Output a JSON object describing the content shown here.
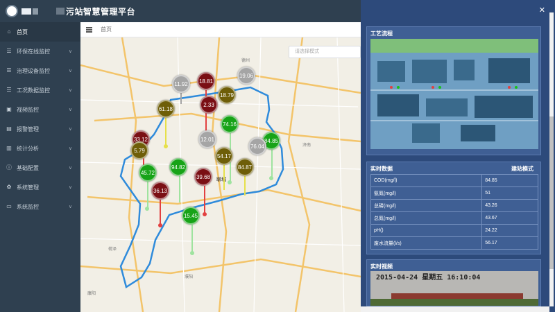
{
  "header": {
    "title": "污站智慧管理平台"
  },
  "sidebar": {
    "items": [
      {
        "label": "首页",
        "icon": "home-icon"
      },
      {
        "label": "环保在线监控",
        "icon": "list-icon"
      },
      {
        "label": "治理设备监控",
        "icon": "list-icon"
      },
      {
        "label": "工况数据监控",
        "icon": "list-icon"
      },
      {
        "label": "视频监控",
        "icon": "video-icon"
      },
      {
        "label": "报警管理",
        "icon": "alarm-icon"
      },
      {
        "label": "统计分析",
        "icon": "chart-icon"
      },
      {
        "label": "基础配置",
        "icon": "info-icon"
      },
      {
        "label": "系统管理",
        "icon": "gear-icon"
      },
      {
        "label": "系统监控",
        "icon": "monitor-icon"
      }
    ]
  },
  "tabs": {
    "home": "首页"
  },
  "map": {
    "mode_placeholder": "请选择模式",
    "cities": [
      "聊城",
      "德州",
      "济南",
      "荷泽",
      "濮阳",
      "康阳"
    ],
    "markers": [
      {
        "value": "11.92",
        "color": "#a5a5a5"
      },
      {
        "value": "18.81",
        "color": "#7a0f14"
      },
      {
        "value": "19.06",
        "color": "#a5a5a5"
      },
      {
        "value": "18.79",
        "color": "#6e5e08"
      },
      {
        "value": "2.33",
        "color": "#7a0f14"
      },
      {
        "value": "61.18",
        "color": "#6e5e08"
      },
      {
        "value": "74.16",
        "color": "#17a317"
      },
      {
        "value": "84.85",
        "color": "#17a317"
      },
      {
        "value": "33.12",
        "color": "#7a0f14"
      },
      {
        "value": "5.79",
        "color": "#6e5e08"
      },
      {
        "value": "12.01",
        "color": "#a5a5a5"
      },
      {
        "value": "76.04",
        "color": "#a5a5a5"
      },
      {
        "value": "54.17",
        "color": "#6e5e08"
      },
      {
        "value": "45.72",
        "color": "#17a317"
      },
      {
        "value": "94.82",
        "color": "#17a317"
      },
      {
        "value": "39.68",
        "color": "#7a0f14"
      },
      {
        "value": "84.87",
        "color": "#6e5e08"
      },
      {
        "value": "36.13",
        "color": "#7a0f14"
      },
      {
        "value": "15.45",
        "color": "#17a317"
      }
    ]
  },
  "panel": {
    "process_title": "工艺流程",
    "realtime_title": "实时数据",
    "realtime_mode": "建站模式",
    "rows": [
      {
        "label": "COD(mg/l)",
        "value": "84.85"
      },
      {
        "label": "氨氮(mg/l)",
        "value": "51"
      },
      {
        "label": "总磷(mg/l)",
        "value": "43.26"
      },
      {
        "label": "总氮(mg/l)",
        "value": "43.67"
      },
      {
        "label": "pH()",
        "value": "24.22"
      },
      {
        "label": "废水流量(l/s)",
        "value": "56.17"
      }
    ],
    "video_title": "实时视频",
    "video_timestamp": "2015-04-24 星期五 16:10:04"
  }
}
